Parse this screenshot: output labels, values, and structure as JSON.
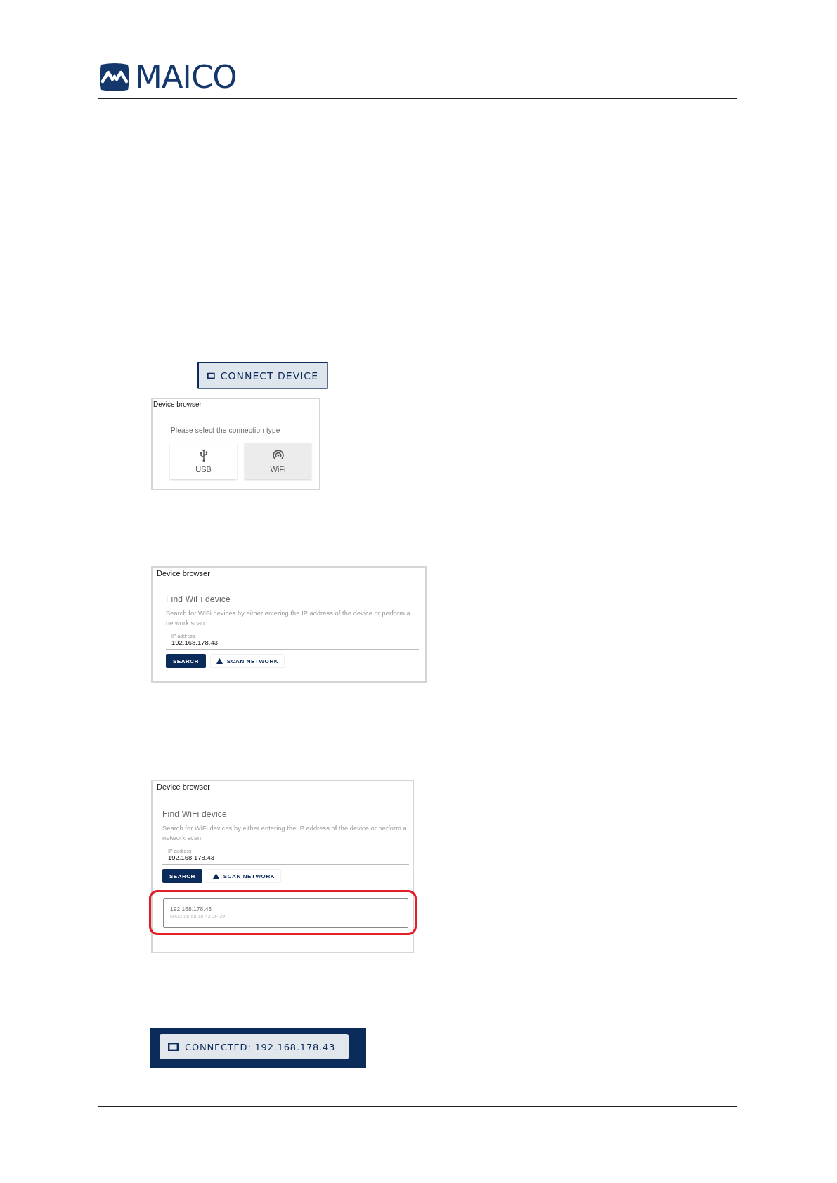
{
  "logo": {
    "text": "MAICO"
  },
  "connect_button": {
    "label": "CONNECT DEVICE"
  },
  "dialogs": [
    {
      "kind": "connection_type",
      "title": "Device browser",
      "prompt": "Please select the connection type",
      "options": [
        {
          "kind": "usb",
          "label": "USB",
          "selected": false
        },
        {
          "kind": "wifi",
          "label": "WiFi",
          "selected": true
        }
      ]
    },
    {
      "kind": "wifi_search",
      "title": "Device browser",
      "heading": "Find WiFi device",
      "description": "Search for WiFi devices by either entering the IP address of the device or perform a network scan.",
      "ip_field": {
        "label": "IP address",
        "value": "192.168.178.43"
      },
      "buttons": [
        {
          "kind": "primary",
          "label": "SEARCH"
        },
        {
          "kind": "scan",
          "label": "SCAN NETWORK"
        }
      ]
    },
    {
      "kind": "wifi_search",
      "title": "Device browser",
      "heading": "Find WiFi device",
      "description": "Search for WiFi devices by either entering the IP address of the device or perform a network scan.",
      "ip_field": {
        "label": "IP address",
        "value": "192.168.178.43"
      },
      "buttons": [
        {
          "kind": "primary",
          "label": "SEARCH"
        },
        {
          "kind": "scan",
          "label": "SCAN NETWORK"
        }
      ],
      "results_highlighted": true,
      "results": [
        {
          "ip": "192.168.178.43",
          "mac": "MAC: 06-58-16-42-2F-29"
        }
      ]
    }
  ],
  "connected_button": {
    "label": "CONNECTED: 192.168.178.43"
  }
}
